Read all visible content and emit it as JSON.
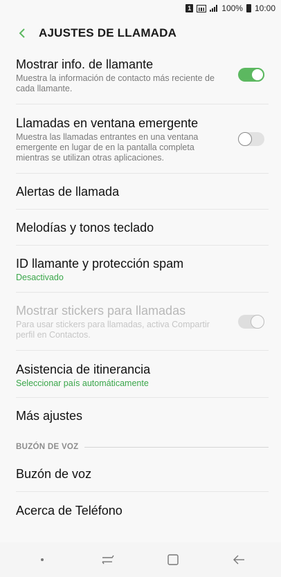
{
  "status_bar": {
    "sim_label": "1",
    "battery_text": "100%",
    "time": "10:00"
  },
  "header": {
    "title": "AJUSTES DE LLAMADA"
  },
  "items": [
    {
      "title": "Mostrar info. de llamante",
      "description": "Muestra la información de contacto más reciente de cada llamante.",
      "toggle": "on"
    },
    {
      "title": "Llamadas en ventana emergente",
      "description": "Muestra las llamadas entrantes en una ventana emergente en lugar de en la pantalla completa mientras se utilizan otras aplicaciones.",
      "toggle": "off"
    },
    {
      "title": "Alertas de llamada"
    },
    {
      "title": "Melodías y tonos teclado"
    },
    {
      "title": "ID llamante y protección spam",
      "subtitle": "Desactivado"
    },
    {
      "title": "Mostrar stickers para llamadas",
      "description": "Para usar stickers para llamadas, activa Compartir perfil en Contactos.",
      "toggle": "on",
      "disabled": true
    },
    {
      "title": "Asistencia de itinerancia",
      "subtitle": "Seleccionar país automáticamente"
    },
    {
      "title": "Más ajustes"
    }
  ],
  "section": {
    "label": "BUZÓN DE VOZ"
  },
  "items2": [
    {
      "title": "Buzón de voz"
    },
    {
      "title": "Acerca de Teléfono"
    }
  ],
  "colors": {
    "accent": "#5cb860",
    "subtitle": "#3aa64a"
  },
  "icons": {
    "back": "chevron-left-icon",
    "nav_home": "home-dot-icon",
    "nav_recents": "recents-icon",
    "nav_overview": "overview-square-icon",
    "nav_back": "back-arrow-icon"
  }
}
